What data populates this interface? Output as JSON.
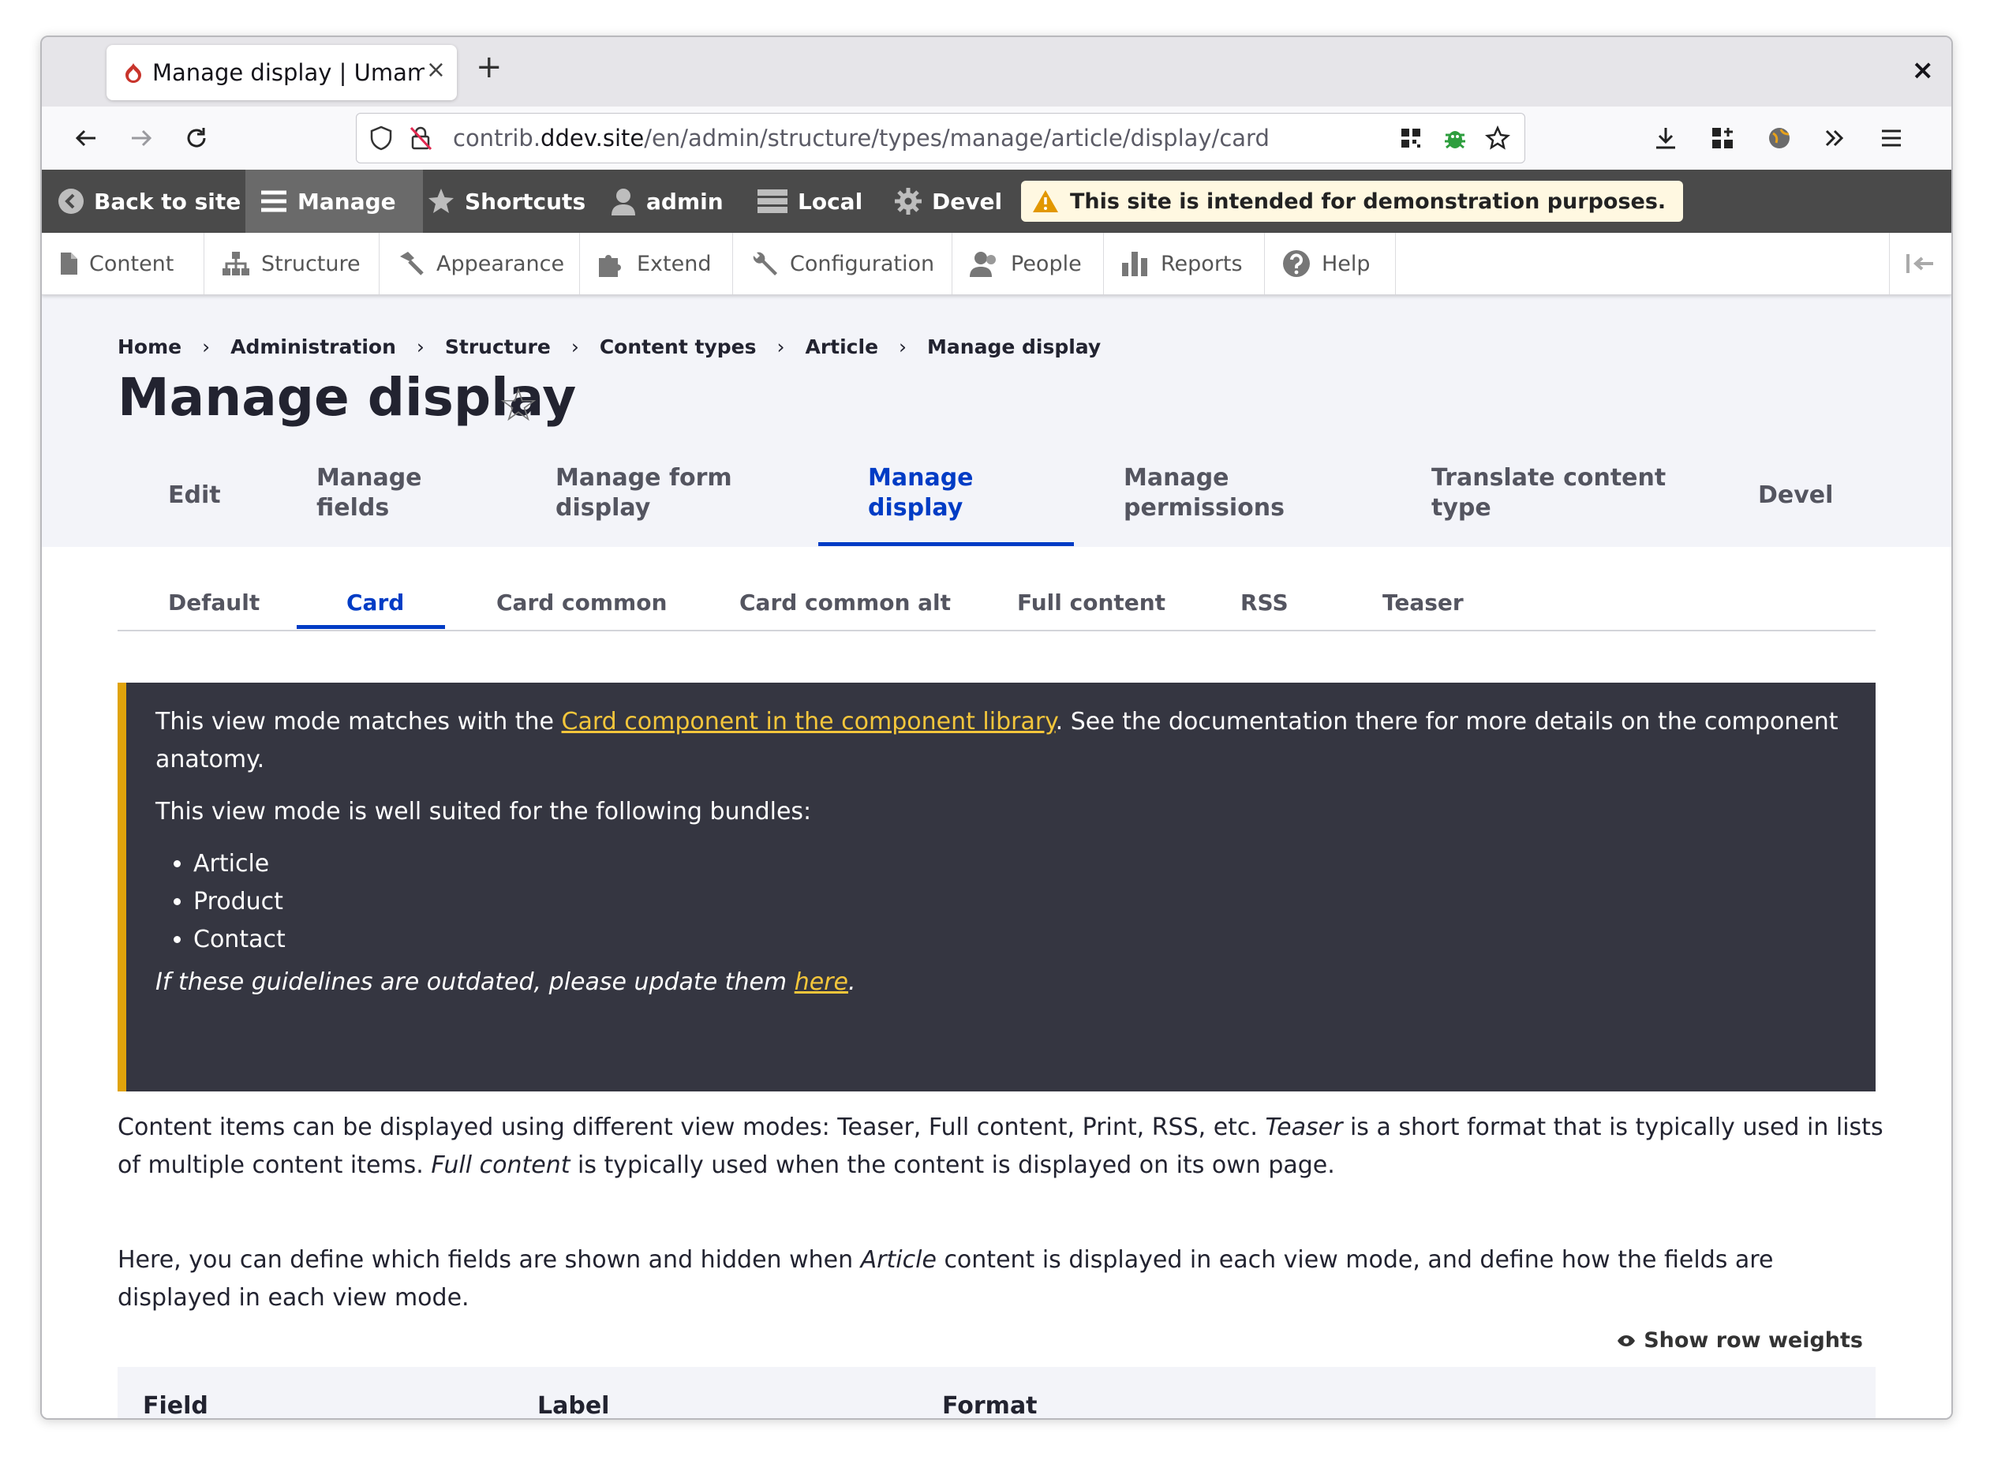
{
  "browser": {
    "tab_title": "Manage display | Umami F",
    "tab_close": "×",
    "new_tab": "+",
    "window_close": "×",
    "url_prefix": "contrib.",
    "url_domain": "ddev.site",
    "url_path": "/en/admin/structure/types/manage/article/display/card"
  },
  "toolbar": {
    "back_to_site": "Back to site",
    "manage": "Manage",
    "shortcuts": "Shortcuts",
    "user": "admin",
    "local": "Local",
    "devel": "Devel",
    "notice": "This site is intended for demonstration purposes."
  },
  "tray": {
    "items": [
      "Content",
      "Structure",
      "Appearance",
      "Extend",
      "Configuration",
      "People",
      "Reports",
      "Help"
    ]
  },
  "breadcrumb": [
    "Home",
    "Administration",
    "Structure",
    "Content types",
    "Article",
    "Manage display"
  ],
  "breadcrumb_sep": "›",
  "page_title": "Manage display",
  "title_star": "☆",
  "primary_tabs": [
    {
      "line1": "Edit",
      "line2": ""
    },
    {
      "line1": "Manage",
      "line2": "fields"
    },
    {
      "line1": "Manage form",
      "line2": "display"
    },
    {
      "line1": "Manage",
      "line2": "display"
    },
    {
      "line1": "Manage",
      "line2": "permissions"
    },
    {
      "line1": "Translate content",
      "line2": "type"
    },
    {
      "line1": "Devel",
      "line2": ""
    }
  ],
  "secondary_tabs": [
    "Default",
    "Card",
    "Card common",
    "Card common alt",
    "Full content",
    "RSS",
    "Teaser"
  ],
  "info": {
    "p1_before": "This view mode matches with the ",
    "p1_link": "Card component in the component library",
    "p1_after": ". See the documentation there for more details on the component anatomy.",
    "p2": "This view mode is well suited for the following bundles:",
    "bundles": [
      "Article",
      "Product",
      "Contact"
    ],
    "p3_before": "If these guidelines are outdated, please update them ",
    "p3_link": "here",
    "p3_after": "."
  },
  "description": {
    "d1_a": "Content items can be displayed using different view modes: Teaser, Full content, Print, RSS, etc. ",
    "d1_em1": "Teaser",
    "d1_b": " is a short format that is typically used in lists of multiple content items. ",
    "d1_em2": "Full content",
    "d1_c": " is typically used when the content is displayed on its own page.",
    "d2_a": "Here, you can define which fields are shown and hidden when ",
    "d2_em": "Article",
    "d2_b": " content is displayed in each view mode, and define how the fields are displayed in each view mode."
  },
  "show_row_weights": "Show row weights",
  "table_headers": [
    "Field",
    "Label",
    "Format"
  ],
  "colors": {
    "accent": "#003cc5",
    "toolbar_bg": "#4a4a4a",
    "infobox_bg": "#353641",
    "infobox_border": "#e0a30b",
    "link_yellow": "#f4c63b"
  }
}
